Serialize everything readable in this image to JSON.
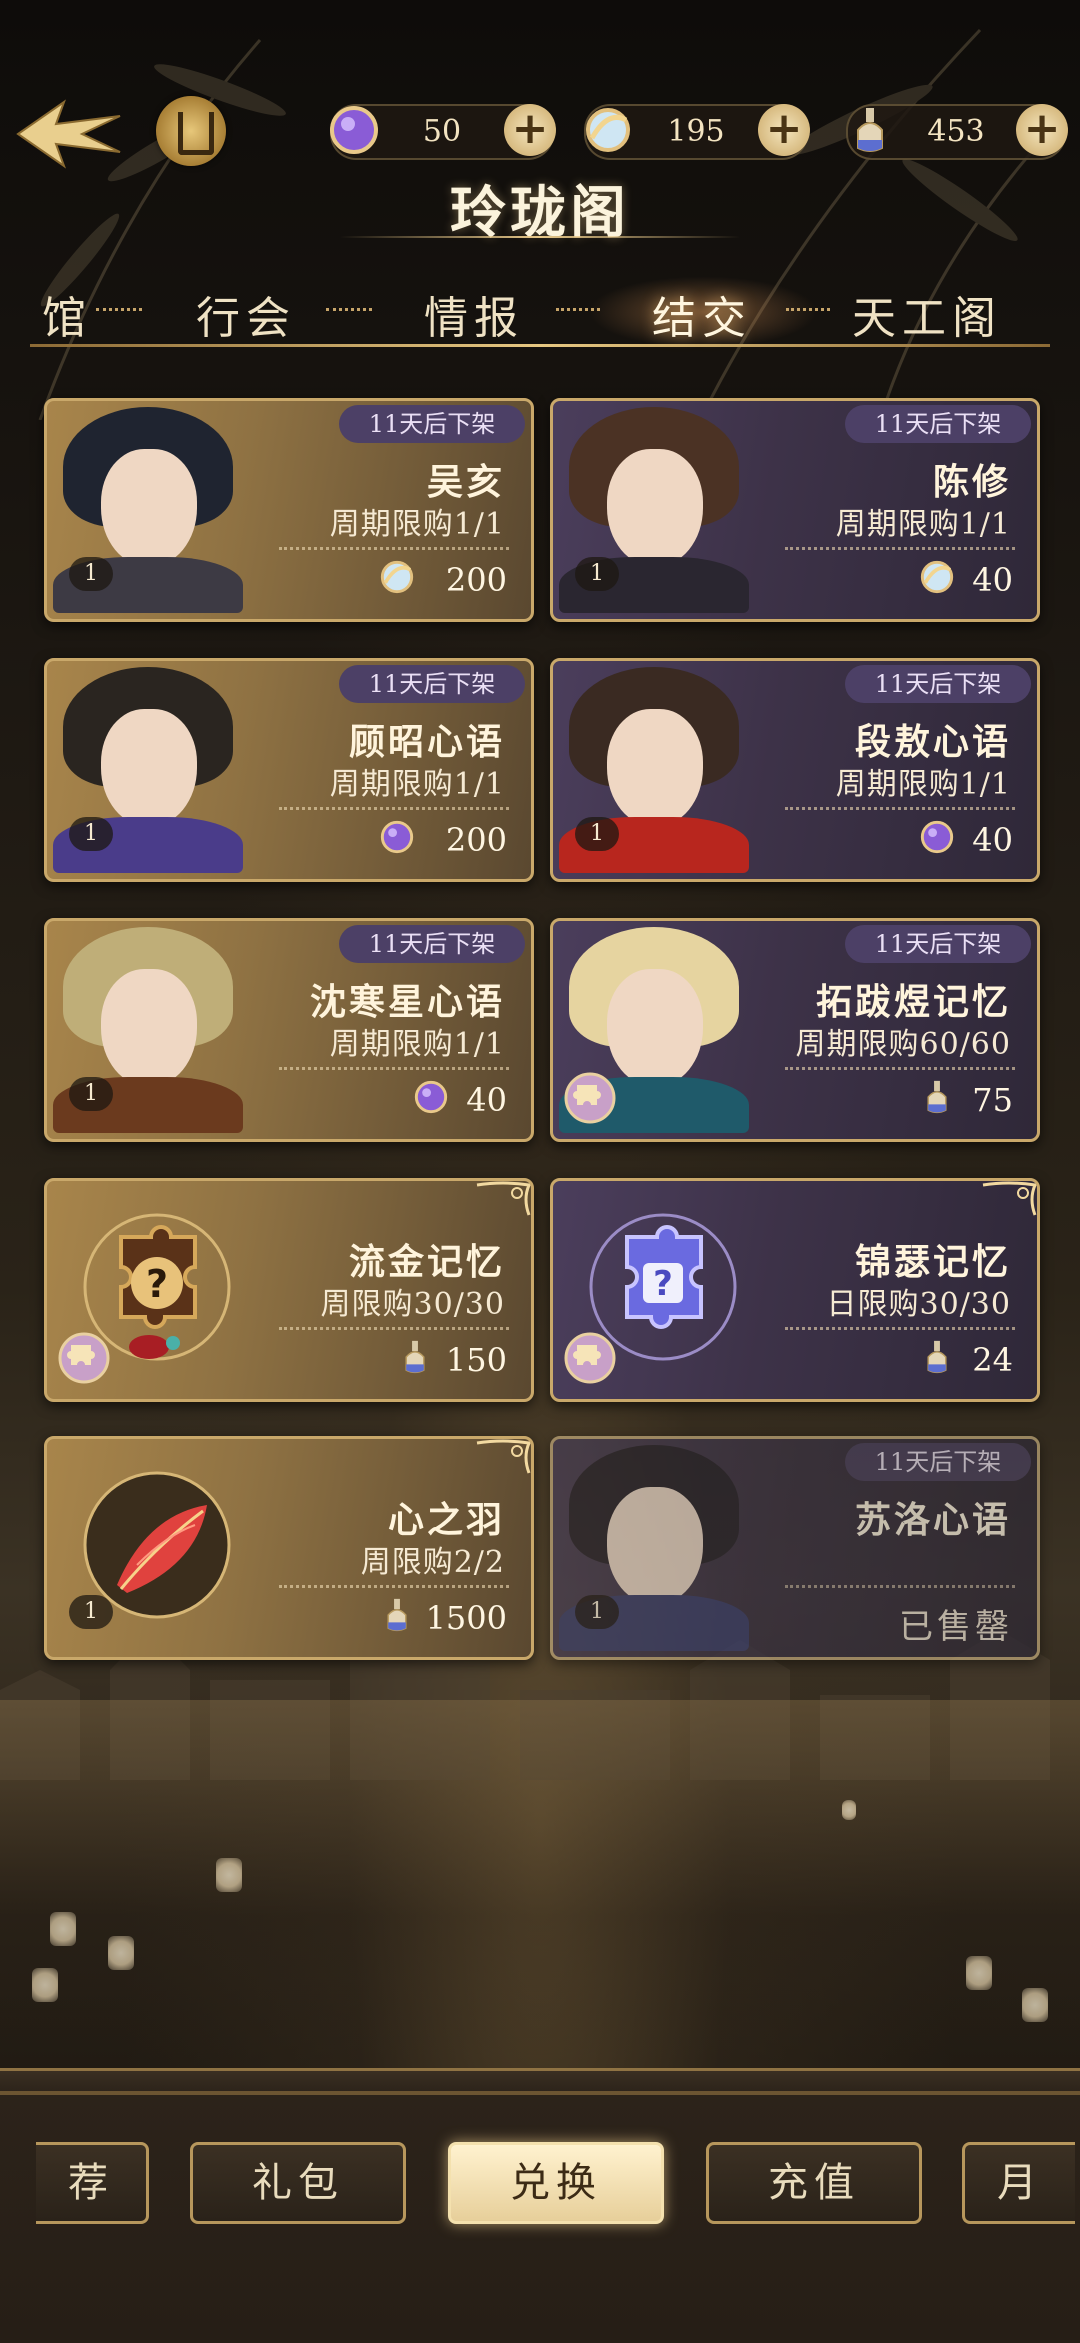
{
  "header": {
    "title": "玲珑阁",
    "currencies": [
      {
        "name": "purple-gem",
        "value": "50"
      },
      {
        "name": "silver-orb",
        "value": "195"
      },
      {
        "name": "bottle",
        "value": "453"
      }
    ]
  },
  "tabs": [
    {
      "label": "馆",
      "active": false
    },
    {
      "label": "行会",
      "active": false
    },
    {
      "label": "情报",
      "active": false
    },
    {
      "label": "结交",
      "active": true
    },
    {
      "label": "天工阁",
      "active": false
    }
  ],
  "items": [
    {
      "name": "吴亥",
      "limit": "周期限购1/1",
      "price": "200",
      "currency": "silver-orb",
      "timer": "11天后下架",
      "count": "1"
    },
    {
      "name": "陈修",
      "limit": "周期限购1/1",
      "price": "40",
      "currency": "silver-orb",
      "timer": "11天后下架",
      "count": "1"
    },
    {
      "name": "顾昭心语",
      "limit": "周期限购1/1",
      "price": "200",
      "currency": "purple-gem",
      "timer": "11天后下架",
      "count": "1"
    },
    {
      "name": "段敖心语",
      "limit": "周期限购1/1",
      "price": "40",
      "currency": "purple-gem",
      "timer": "11天后下架",
      "count": "1"
    },
    {
      "name": "沈寒星心语",
      "limit": "周期限购1/1",
      "price": "40",
      "currency": "purple-gem",
      "timer": "11天后下架",
      "count": "1"
    },
    {
      "name": "拓跋煜记忆",
      "limit": "周期限购60/60",
      "price": "75",
      "currency": "bottle",
      "timer": "11天后下架"
    },
    {
      "name": "流金记忆",
      "limit": "周限购30/30",
      "price": "150",
      "currency": "bottle"
    },
    {
      "name": "锦瑟记忆",
      "limit": "日限购30/30",
      "price": "24",
      "currency": "bottle"
    },
    {
      "name": "心之羽",
      "limit": "周限购2/2",
      "price": "1500",
      "currency": "bottle",
      "count": "1"
    },
    {
      "name": "苏洛心语",
      "timer": "11天后下架",
      "status": "已售罄",
      "count": "1"
    }
  ],
  "bottom_nav": [
    {
      "label": "荐",
      "active": false
    },
    {
      "label": "礼包",
      "active": false
    },
    {
      "label": "兑换",
      "active": true
    },
    {
      "label": "充值",
      "active": false
    },
    {
      "label": "月",
      "active": false
    }
  ]
}
